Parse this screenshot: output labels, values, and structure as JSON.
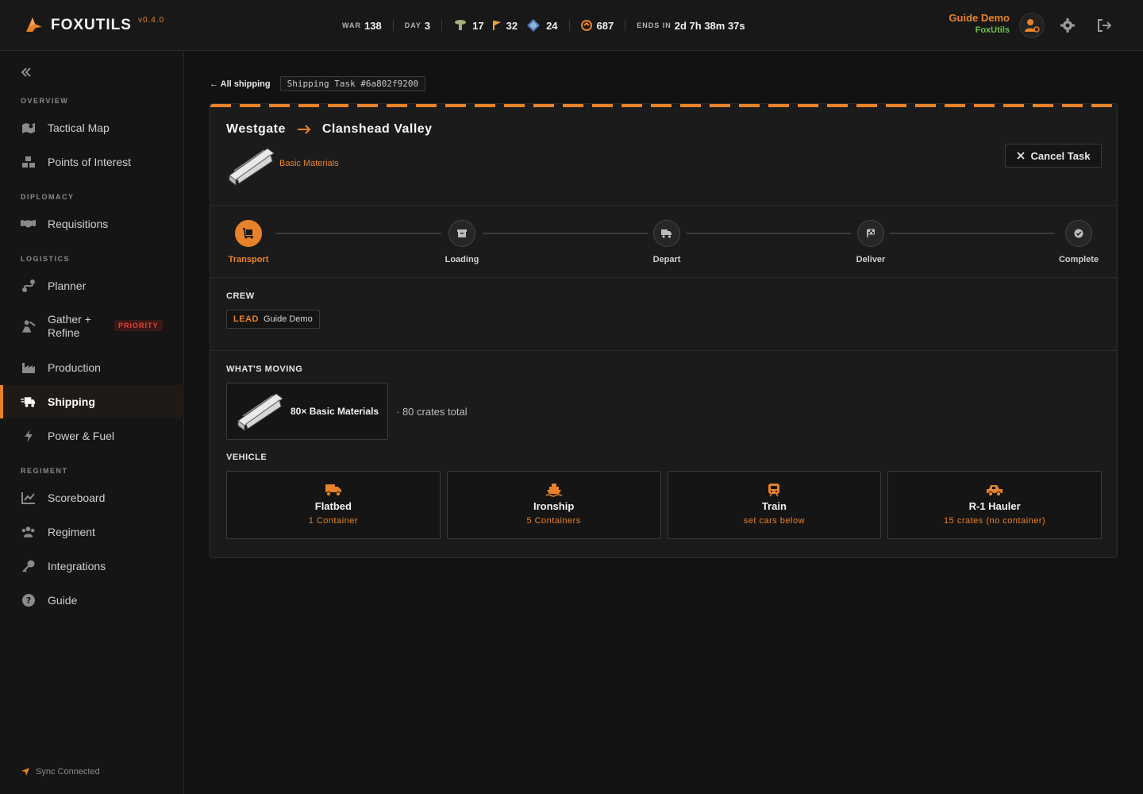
{
  "app": {
    "name": "FOXUTILS",
    "version": "v0.4.0"
  },
  "header": {
    "war_label": "WAR",
    "war_value": "138",
    "day_label": "DAY",
    "day_value": "3",
    "stat_a": "17",
    "stat_b": "32",
    "stat_c": "24",
    "stat_d": "687",
    "ends_label": "ENDS IN",
    "ends_value": "2d 7h 38m 37s",
    "user_name": "Guide Demo",
    "user_org": "FoxUtils"
  },
  "sidebar": {
    "sections": {
      "overview": "OVERVIEW",
      "diplomacy": "DIPLOMACY",
      "logistics": "LOGISTICS",
      "regiment": "REGIMENT"
    },
    "items": {
      "tactical_map": "Tactical Map",
      "poi": "Points of Interest",
      "requisitions": "Requisitions",
      "planner": "Planner",
      "gather_refine_1": "Gather +",
      "gather_refine_2": "Refine",
      "priority": "PRIORITY",
      "production": "Production",
      "shipping": "Shipping",
      "power_fuel": "Power & Fuel",
      "scoreboard": "Scoreboard",
      "regiment": "Regiment",
      "integrations": "Integrations",
      "guide": "Guide"
    },
    "sync": "Sync Connected"
  },
  "crumbs": {
    "back": "← All shipping",
    "task": "Shipping Task #6a802f9200"
  },
  "task": {
    "origin": "Westgate",
    "destination": "Clanshead Valley",
    "cargo_type": "Basic Materials",
    "cancel_label": "Cancel Task",
    "steps": [
      "Transport",
      "Loading",
      "Depart",
      "Deliver",
      "Complete"
    ],
    "crew_title": "CREW",
    "crew_lead_label": "LEAD",
    "crew_lead_name": "Guide Demo",
    "moving_title": "WHAT'S MOVING",
    "moving_qty": "80× Basic Materials",
    "moving_total": "· 80 crates total",
    "vehicle_title": "VEHICLE",
    "vehicles": [
      {
        "name": "Flatbed",
        "sub": "1 Container"
      },
      {
        "name": "Ironship",
        "sub": "5 Containers"
      },
      {
        "name": "Train",
        "sub": "set cars below"
      },
      {
        "name": "R-1 Hauler",
        "sub": "15 crates (no container)"
      }
    ]
  },
  "colors": {
    "accent": "#e8822a",
    "background": "#121212",
    "panel": "#1b1b1b",
    "org_green": "#6fbf4a",
    "priority_red": "#e0443b"
  }
}
